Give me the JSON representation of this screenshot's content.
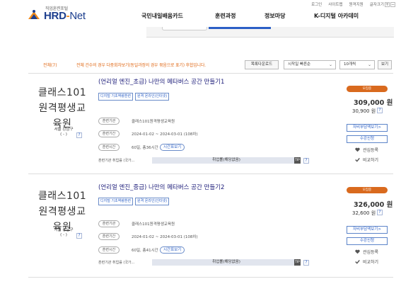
{
  "header": {
    "logo_sub": "직업훈련포털",
    "logo_main_a": "HRD",
    "logo_main_dash": "-",
    "logo_main_b": "Net",
    "util": [
      "로그인",
      "사이트맵",
      "원격지원",
      "글자크기"
    ],
    "font_up": "+",
    "font_down": "−",
    "gnb": [
      "국민내일배움카드",
      "훈련과정",
      "정보마당",
      "K-디지털 아카데미"
    ]
  },
  "toolbar": {
    "count": "전체(7)",
    "notice": "전체 건수의 경우 다중회차보기(동일과정의 경우 묶음으로 표기) 후합입니다.",
    "multi_btn": "목록다운로드",
    "sort_select": "시작일 빠른순",
    "per_page_select": "10개씩",
    "view_btn": "보기"
  },
  "courses": [
    {
      "org": [
        "클래스101",
        "원격평생교",
        "육원"
      ],
      "location": [
        "서울 강남구",
        "( - )"
      ],
      "title": "(언리얼 엔진_초급) 나만의 메타버스 공간 만들기1",
      "tags": [
        "디지털 기초역량훈련",
        "원격 온라인(인터넷)"
      ],
      "labels": [
        "훈련기관",
        "훈련기간",
        "훈련시간"
      ],
      "institution": "클래스101원격평생교육원",
      "period": "2024-01-02 ~ 2024-03-01 (108차)",
      "hours": "60일, 총36시간",
      "time_btn": "시간표보기",
      "employment_label": "훈련기관 취업률 (국가...",
      "employment_bar": "취업률(해당없음)",
      "tip": "TIP",
      "badge": "모집중",
      "price": "309,000 원",
      "subprice": "30,900 원",
      "btn_self": "자비부담액보기>",
      "btn_apply": "수강신청",
      "interest": "관심등록",
      "compare": "비교하기"
    },
    {
      "org": [
        "클래스101",
        "원격평생교",
        "육원"
      ],
      "location": [
        "서울 강남구",
        "( - )"
      ],
      "title": "(언리얼 엔진_중급) 나만의 메타버스 공간 만들기2",
      "tags": [
        "디지털 기초역량훈련",
        "원격 온라인(인터넷)"
      ],
      "labels": [
        "훈련기관",
        "훈련기간",
        "훈련시간"
      ],
      "institution": "클래스101원격평생교육원",
      "period": "2024-01-02 ~ 2024-03-01 (108차)",
      "hours": "60일, 총41시간",
      "time_btn": "시간표보기",
      "employment_label": "훈련기관 취업률 (국가...",
      "employment_bar": "취업률(해당없음)",
      "tip": "TIP",
      "badge": "모집중",
      "price": "326,000 원",
      "subprice": "32,600 원",
      "btn_self": "자비부담액보기>",
      "btn_apply": "수강신청",
      "interest": "관심등록",
      "compare": "비교하기"
    }
  ],
  "colors": {
    "brand": "#1d3f8e",
    "accent": "#d96a1e",
    "link": "#2b5fc6"
  },
  "icons": {
    "heart": "heart-icon",
    "check": "check-icon",
    "question": "question-icon"
  }
}
